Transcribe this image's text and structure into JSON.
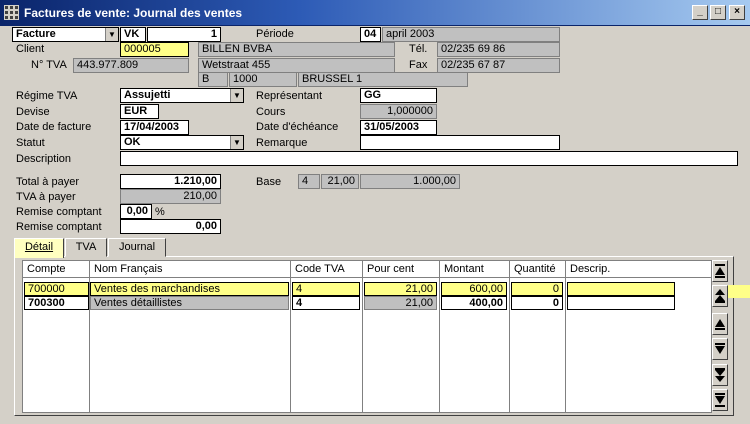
{
  "window": {
    "title": "Factures de vente: Journal des ventes",
    "minimize": "_",
    "maximize": "□",
    "close": "×"
  },
  "header": {
    "doc_type": "Facture",
    "journal": "VK",
    "doc_number": "1",
    "periode_label": "Période",
    "periode_num": "04",
    "periode_text": "april 2003"
  },
  "client": {
    "label": "Client",
    "code": "000005",
    "name": "BILLEN BVBA",
    "street": "Wetstraat 455",
    "country": "B",
    "postcode": "1000",
    "city": "BRUSSEL 1",
    "tva_label": "N° TVA",
    "tva": "443.977.809",
    "tel_label": "Tél.",
    "tel": "02/235 69 86",
    "fax_label": "Fax",
    "fax": "02/235 67 87"
  },
  "fields": {
    "regime_label": "Régime TVA",
    "regime": "Assujetti",
    "devise_label": "Devise",
    "devise": "EUR",
    "date_label": "Date de facture",
    "date": "17/04/2003",
    "statut_label": "Statut",
    "statut": "OK",
    "description_label": "Description",
    "description": "",
    "rep_label": "Représentant",
    "rep": "GG",
    "cours_label": "Cours",
    "cours": "1,000000",
    "echeance_label": "Date d'échéance",
    "echeance": "31/05/2003",
    "remarque_label": "Remarque",
    "remarque": ""
  },
  "totals": {
    "total_label": "Total à payer",
    "total": "1.210,00",
    "tva_label": "TVA à payer",
    "tva": "210,00",
    "remise_label": "Remise comptant",
    "remise_pct": "0,00",
    "pct_sign": "%",
    "remise2_label": "Remise comptant",
    "remise_amount": "0,00",
    "base_label": "Base",
    "base_code": "4",
    "base_rate": "21,00",
    "base_amount": "1.000,00"
  },
  "tabs": [
    {
      "label": "Détail"
    },
    {
      "label": "TVA"
    },
    {
      "label": "Journal"
    }
  ],
  "table": {
    "headers": [
      "Compte",
      "Nom Français",
      "Code TVA",
      "Pour cent",
      "Montant",
      "Quantité",
      "Descrip."
    ],
    "rows": [
      [
        "700000",
        "Ventes des marchandises",
        "4",
        "21,00",
        "600,00",
        "0",
        ""
      ],
      [
        "700300",
        "Ventes détaillistes",
        "4",
        "21,00",
        "400,00",
        "0",
        ""
      ]
    ]
  },
  "colors": {
    "highlight": "#ffff88",
    "titlebar": "#0a246a",
    "face": "#d4d0c8"
  },
  "icons": [
    "app-grid-icon",
    "first-record-icon",
    "previous-page-icon",
    "previous-record-icon",
    "next-record-icon",
    "next-page-icon",
    "last-record-icon"
  ]
}
